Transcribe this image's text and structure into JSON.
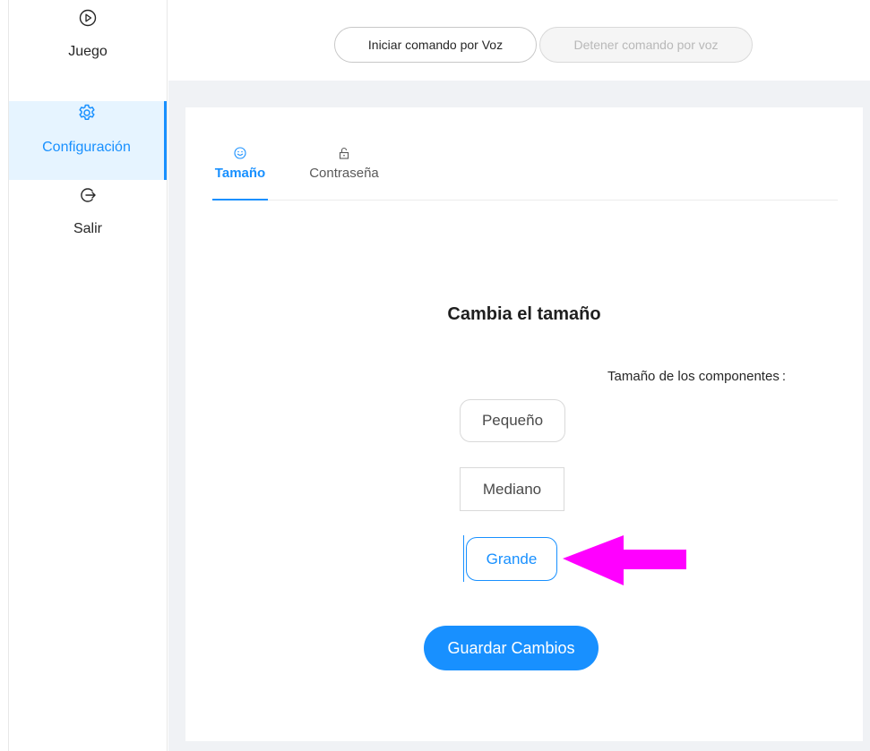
{
  "sidebar": {
    "items": [
      {
        "label": "Juego",
        "icon": "play-circle-icon"
      },
      {
        "label": "Configuración",
        "icon": "gear-icon"
      },
      {
        "label": "Salir",
        "icon": "logout-icon"
      }
    ]
  },
  "header": {
    "start_voice_label": "Iniciar comando por Voz",
    "stop_voice_label": "Detener comando por voz"
  },
  "tabs": [
    {
      "label": "Tamaño",
      "icon": "smile-icon",
      "active": true
    },
    {
      "label": "Contraseña",
      "icon": "unlock-icon",
      "active": false
    }
  ],
  "main": {
    "title": "Cambia el tamaño",
    "field_label": "Tamaño de los componentes",
    "field_colon": ":",
    "options": {
      "small": "Pequeño",
      "medium": "Mediano",
      "large": "Grande"
    },
    "save_label": "Guardar Cambios"
  },
  "annotation": {
    "arrow_color": "#ff00ff",
    "points_to": "Grande"
  },
  "colors": {
    "accent": "#1890ff",
    "content_bg": "#f0f2f5",
    "active_bg": "#e6f4ff"
  }
}
